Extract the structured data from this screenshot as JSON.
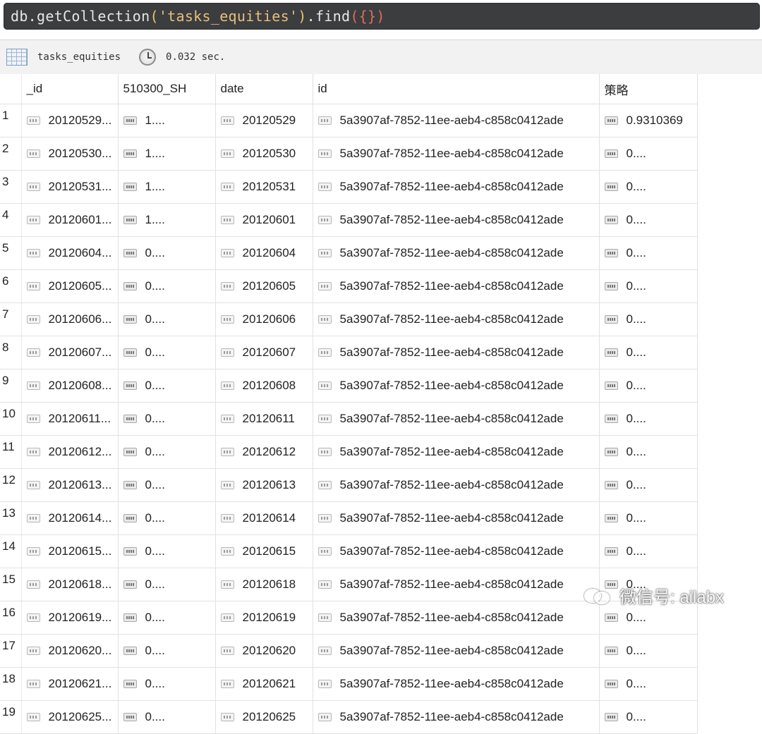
{
  "query": {
    "prefix": "db.",
    "method": "getCollection",
    "open_paren": "(",
    "collection_arg": "'tasks_equities'",
    "close_paren": ")",
    "find_method": ".find",
    "find_args": "({})"
  },
  "status": {
    "collection_name": "tasks_equities",
    "elapsed": "0.032 sec."
  },
  "columns": [
    {
      "label": "_id",
      "type": "string"
    },
    {
      "label": "510300_SH",
      "type": "number"
    },
    {
      "label": "date",
      "type": "string"
    },
    {
      "label": "id",
      "type": "string"
    },
    {
      "label": "策略",
      "type": "number"
    }
  ],
  "rows": [
    {
      "n": "1",
      "_id": "20120529...",
      "v510300": "1....",
      "date": "20120529",
      "id": "5a3907af-7852-11ee-aeb4-c858c0412ade",
      "strategy": "0.9310369"
    },
    {
      "n": "2",
      "_id": "20120530...",
      "v510300": "1....",
      "date": "20120530",
      "id": "5a3907af-7852-11ee-aeb4-c858c0412ade",
      "strategy": "0...."
    },
    {
      "n": "3",
      "_id": "20120531...",
      "v510300": "1....",
      "date": "20120531",
      "id": "5a3907af-7852-11ee-aeb4-c858c0412ade",
      "strategy": "0...."
    },
    {
      "n": "4",
      "_id": "20120601...",
      "v510300": "1....",
      "date": "20120601",
      "id": "5a3907af-7852-11ee-aeb4-c858c0412ade",
      "strategy": "0...."
    },
    {
      "n": "5",
      "_id": "20120604...",
      "v510300": "0....",
      "date": "20120604",
      "id": "5a3907af-7852-11ee-aeb4-c858c0412ade",
      "strategy": "0...."
    },
    {
      "n": "6",
      "_id": "20120605...",
      "v510300": "0....",
      "date": "20120605",
      "id": "5a3907af-7852-11ee-aeb4-c858c0412ade",
      "strategy": "0...."
    },
    {
      "n": "7",
      "_id": "20120606...",
      "v510300": "0....",
      "date": "20120606",
      "id": "5a3907af-7852-11ee-aeb4-c858c0412ade",
      "strategy": "0...."
    },
    {
      "n": "8",
      "_id": "20120607...",
      "v510300": "0....",
      "date": "20120607",
      "id": "5a3907af-7852-11ee-aeb4-c858c0412ade",
      "strategy": "0...."
    },
    {
      "n": "9",
      "_id": "20120608...",
      "v510300": "0....",
      "date": "20120608",
      "id": "5a3907af-7852-11ee-aeb4-c858c0412ade",
      "strategy": "0...."
    },
    {
      "n": "10",
      "_id": "20120611...",
      "v510300": "0....",
      "date": "20120611",
      "id": "5a3907af-7852-11ee-aeb4-c858c0412ade",
      "strategy": "0...."
    },
    {
      "n": "11",
      "_id": "20120612...",
      "v510300": "0....",
      "date": "20120612",
      "id": "5a3907af-7852-11ee-aeb4-c858c0412ade",
      "strategy": "0...."
    },
    {
      "n": "12",
      "_id": "20120613...",
      "v510300": "0....",
      "date": "20120613",
      "id": "5a3907af-7852-11ee-aeb4-c858c0412ade",
      "strategy": "0...."
    },
    {
      "n": "13",
      "_id": "20120614...",
      "v510300": "0....",
      "date": "20120614",
      "id": "5a3907af-7852-11ee-aeb4-c858c0412ade",
      "strategy": "0...."
    },
    {
      "n": "14",
      "_id": "20120615...",
      "v510300": "0....",
      "date": "20120615",
      "id": "5a3907af-7852-11ee-aeb4-c858c0412ade",
      "strategy": "0...."
    },
    {
      "n": "15",
      "_id": "20120618...",
      "v510300": "0....",
      "date": "20120618",
      "id": "5a3907af-7852-11ee-aeb4-c858c0412ade",
      "strategy": "0...."
    },
    {
      "n": "16",
      "_id": "20120619...",
      "v510300": "0....",
      "date": "20120619",
      "id": "5a3907af-7852-11ee-aeb4-c858c0412ade",
      "strategy": "0...."
    },
    {
      "n": "17",
      "_id": "20120620...",
      "v510300": "0....",
      "date": "20120620",
      "id": "5a3907af-7852-11ee-aeb4-c858c0412ade",
      "strategy": "0...."
    },
    {
      "n": "18",
      "_id": "20120621...",
      "v510300": "0....",
      "date": "20120621",
      "id": "5a3907af-7852-11ee-aeb4-c858c0412ade",
      "strategy": "0...."
    },
    {
      "n": "19",
      "_id": "20120625...",
      "v510300": "0....",
      "date": "20120625",
      "id": "5a3907af-7852-11ee-aeb4-c858c0412ade",
      "strategy": "0...."
    }
  ],
  "watermark": {
    "text": "微信号: ailabx"
  }
}
